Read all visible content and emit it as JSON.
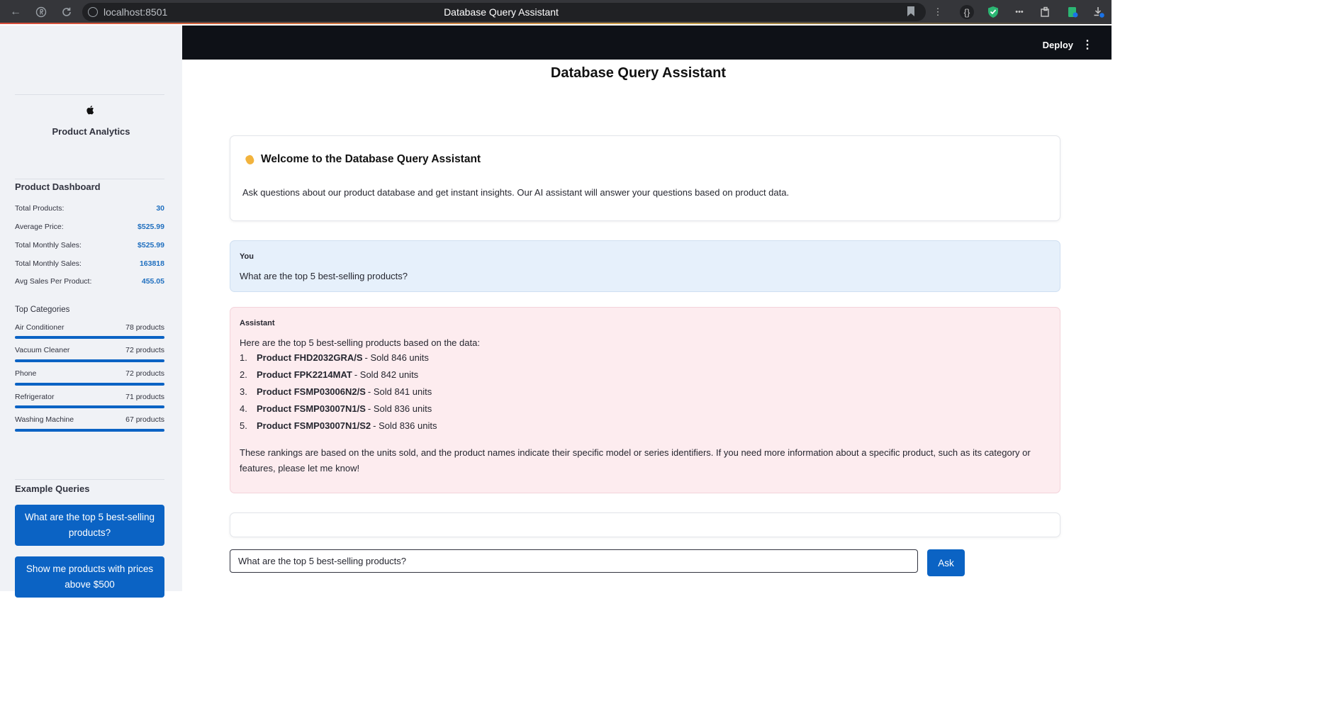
{
  "browser": {
    "url": "localhost:8501",
    "tab_title": "Database Query Assistant"
  },
  "sidebar": {
    "brand": "Product Analytics",
    "dashboard_title": "Product Dashboard",
    "stats": [
      {
        "label": "Total Products:",
        "value": "30"
      },
      {
        "label": "Average Price:",
        "value": "$525.99"
      },
      {
        "label": "Total Monthly Sales:",
        "value": "$525.99"
      },
      {
        "label": "Total Monthly Sales:",
        "value": "163818"
      },
      {
        "label": "Avg Sales Per Product:",
        "value": "455.05"
      }
    ],
    "top_categories_title": "Top Categories",
    "categories": [
      {
        "name": "Air Conditioner",
        "count": "78 products",
        "level": 1.0
      },
      {
        "name": "Vacuum Cleaner",
        "count": "72 products",
        "level": 1.0
      },
      {
        "name": "Phone",
        "count": "72 products",
        "level": 1.0
      },
      {
        "name": "Refrigerator",
        "count": "71 products",
        "level": 1.0
      },
      {
        "name": "Washing Machine",
        "count": "67 products",
        "level": 1.0
      }
    ],
    "example_queries_title": "Example Queries",
    "example_queries": [
      "What are the top 5 best-selling products?",
      "Show me products with prices above $500"
    ]
  },
  "header": {
    "deploy_label": "Deploy",
    "menu_icon": "kebab-menu-icon"
  },
  "main": {
    "title": "Database Query Assistant",
    "welcome": {
      "heading": "Welcome to the Database Query Assistant",
      "icon": "waving-hand-icon",
      "text": "Ask questions about our product database and get instant insights. Our AI assistant will answer your questions based on product data."
    },
    "user_message": {
      "role": "You",
      "text": "What are the top 5 best-selling products?"
    },
    "assistant_message": {
      "role": "Assistant",
      "intro": "Here are the top 5 best-selling products based on the data:",
      "items": [
        {
          "num": "1.",
          "product": "Product FHD2032GRA/S",
          "detail": "- Sold 846 units"
        },
        {
          "num": "2.",
          "product": "Product FPK2214MAT",
          "detail": "- Sold 842 units"
        },
        {
          "num": "3.",
          "product": "Product FSMP03006N2/S",
          "detail": "- Sold 841 units"
        },
        {
          "num": "4.",
          "product": "Product FSMP03007N1/S",
          "detail": "- Sold 836 units"
        },
        {
          "num": "5.",
          "product": "Product FSMP03007N1/S2",
          "detail": "- Sold 836 units"
        }
      ],
      "closing": "These rankings are based on the units sold, and the product names indicate their specific model or series identifiers. If you need more information about a specific product, such as its category or features, please let me know!"
    },
    "query_input_value": "What are the top 5 best-selling products?",
    "ask_label": "Ask"
  },
  "colors": {
    "accent": "#0b63c4",
    "user_bubble": "#e6f0fb",
    "assistant_bubble": "#fdecef",
    "sidebar_bg": "#f0f2f6",
    "header_bg": "#0e1117"
  }
}
